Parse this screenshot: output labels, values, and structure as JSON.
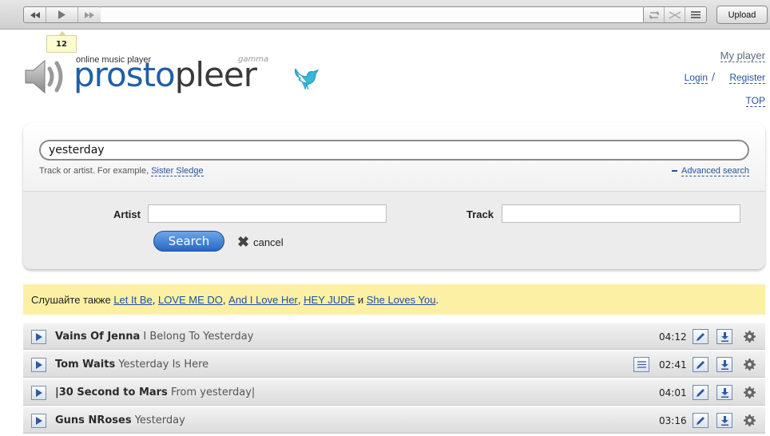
{
  "player": {
    "upload_label": "Upload",
    "counter": "12"
  },
  "logo": {
    "tagline": "online music player",
    "word_part1": "prosto",
    "word_part2": "pleer",
    "badge": "gamma"
  },
  "header_links": {
    "my_player": "My player",
    "login": "Login",
    "separator": "/",
    "register": "Register",
    "top": "TOP"
  },
  "search": {
    "query": "yesterday",
    "hint_prefix": "Track or artist. For example,",
    "hint_example": "Sister Sledge",
    "advanced_label": "Advanced search",
    "artist_label": "Artist",
    "artist_value": "",
    "track_label": "Track",
    "track_value": "",
    "search_button": "Search",
    "cancel_label": "cancel"
  },
  "suggestions": {
    "prefix": "Слушайте также",
    "items": [
      "Let It Be",
      "LOVE ME DO",
      "And I Love Her",
      "HEY JUDE",
      "She Loves You"
    ],
    "sep1": ",",
    "sep2": ",",
    "sep3": ",",
    "and_word": "и",
    "end": "."
  },
  "tracks": [
    {
      "artist": "Vains Of Jenna",
      "title": "I Belong To Yesterday",
      "duration": "04:12",
      "has_lyrics": false
    },
    {
      "artist": "Tom Waits",
      "title": "Yesterday Is Here",
      "duration": "02:41",
      "has_lyrics": true
    },
    {
      "artist": "|30 Second to Mars",
      "title": "From yesterday|",
      "duration": "04:01",
      "has_lyrics": false
    },
    {
      "artist": "Guns NRoses",
      "title": "Yesterday",
      "duration": "03:16",
      "has_lyrics": false
    }
  ],
  "colors": {
    "accent_blue": "#1f5fa7",
    "link": "#27529c",
    "suggest_bg": "#fcf0a5",
    "twitter_bird": "#39b6d8"
  }
}
